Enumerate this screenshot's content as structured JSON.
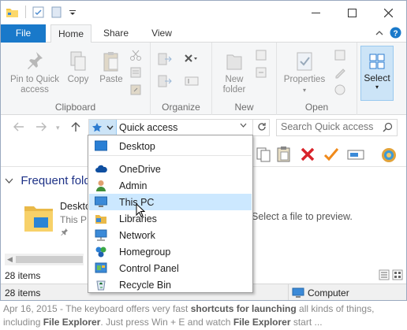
{
  "ribbon_tabs": {
    "file": "File",
    "home": "Home",
    "share": "Share",
    "view": "View"
  },
  "clipboard": {
    "pin": [
      "Pin to Quick",
      "access"
    ],
    "copy": "Copy",
    "paste": "Paste",
    "label": "Clipboard"
  },
  "organize": {
    "label": "Organize"
  },
  "new_group": {
    "new_folder": [
      "New",
      "folder"
    ],
    "label": "New"
  },
  "open_group": {
    "properties": "Properties",
    "label": "Open"
  },
  "select": {
    "label": "Select"
  },
  "address": {
    "location": "Quick access"
  },
  "search": {
    "placeholder": "Search Quick access"
  },
  "content": {
    "section_title": "Frequent fold",
    "item_name": "Deskto",
    "item_sub": "This P",
    "preview": "Select a file to preview."
  },
  "status": {
    "top_items": "28 items",
    "items": "28 items",
    "computer": "Computer"
  },
  "dropdown": {
    "items": [
      {
        "label": "Desktop",
        "icon": "desktop-icon"
      },
      {
        "label": "OneDrive",
        "icon": "cloud-icon"
      },
      {
        "label": "Admin",
        "icon": "user-icon"
      },
      {
        "label": "This PC",
        "icon": "computer-icon",
        "highlighted": true
      },
      {
        "label": "Libraries",
        "icon": "library-icon"
      },
      {
        "label": "Network",
        "icon": "network-icon"
      },
      {
        "label": "Homegroup",
        "icon": "homegroup-icon"
      },
      {
        "label": "Control Panel",
        "icon": "control-panel-icon"
      },
      {
        "label": "Recycle Bin",
        "icon": "recycle-bin-icon"
      }
    ]
  },
  "caption": {
    "date": "Apr 16, 2015 - ",
    "t1": "The keyboard offers very fast ",
    "b1": "shortcuts for launching",
    "t2": " all kinds of things,",
    "t3": "including ",
    "b2": "File Explorer",
    "t4": ". Just press Win + E and watch ",
    "b3": "File Explorer",
    "t5": " start ..."
  },
  "colors": {
    "accent": "#1979ca",
    "highlight": "#cce8ff",
    "select_bg": "#cce4f7"
  }
}
